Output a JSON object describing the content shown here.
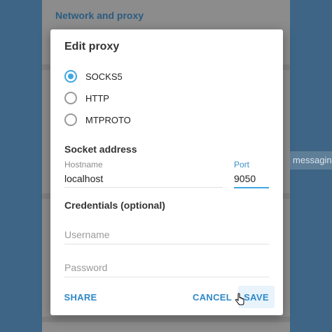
{
  "background": {
    "section_title": "Network and proxy",
    "side_label": "messagin"
  },
  "dialog": {
    "title": "Edit proxy",
    "proxy_types": [
      {
        "label": "SOCKS5",
        "selected": true
      },
      {
        "label": "HTTP",
        "selected": false
      },
      {
        "label": "MTPROTO",
        "selected": false
      }
    ],
    "socket_section_title": "Socket address",
    "hostname": {
      "label": "Hostname",
      "value": "localhost"
    },
    "port": {
      "label": "Port",
      "value": "9050"
    },
    "credentials_section_title": "Credentials (optional)",
    "username": {
      "placeholder": "Username",
      "value": ""
    },
    "password": {
      "placeholder": "Password",
      "value": ""
    },
    "buttons": {
      "share": "SHARE",
      "cancel": "CANCEL",
      "save": "SAVE"
    }
  },
  "colors": {
    "accent": "#40a7e3",
    "link": "#2f89c9",
    "overlay_side": "#3e6585"
  }
}
